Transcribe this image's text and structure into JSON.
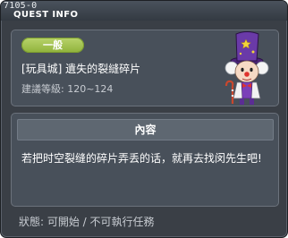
{
  "window": {
    "id_text": "7105-0",
    "title": "QUEST INFO"
  },
  "quest": {
    "badge": "一般",
    "name": "[玩具城] 遺失的裂縫碎片",
    "level_requirement": "建議等級: 120~124",
    "npc_icon": "clown-npc-portrait"
  },
  "content": {
    "header": "內容",
    "body": "若把时空裂缝的碎片弄丢的话，就再去找闵先生吧!"
  },
  "status": {
    "text": "狀態:  可開始  /  不可執行任務"
  },
  "colors": {
    "window_bg": "#3a3f46",
    "panel_bg": "#48505a",
    "badge_green": "#9dbd48",
    "npc_hat_purple": "#6a3aa8"
  }
}
